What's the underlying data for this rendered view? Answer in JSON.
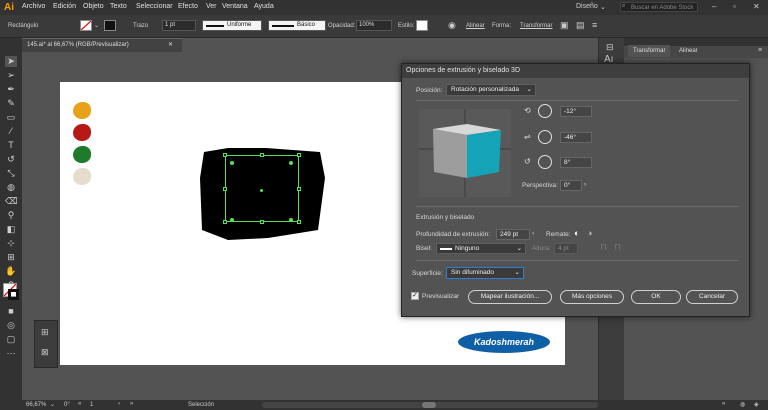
{
  "menubar": {
    "app_logo": "Ai",
    "items": [
      "Archivo",
      "Edición",
      "Objeto",
      "Texto",
      "Seleccionar",
      "Efecto",
      "Ver",
      "Ventana",
      "Ayuda"
    ],
    "workspace": "Diseño",
    "search_placeholder": "Buscar en Adobe Stock"
  },
  "controlbar": {
    "object_type": "Rectángulo",
    "stroke_label": "Trazo",
    "stroke_weight": "1 pt",
    "profile": "Uniforme",
    "brush": "Básico",
    "opacity_label": "Opacidad:",
    "opacity_value": "100%",
    "style_label": "Estilo:",
    "align_label": "Alinear",
    "shape_label": "Forma:",
    "transform_label": "Transformar"
  },
  "document": {
    "tab_title": "145.ai* al 66,67% (RGB/Previsualizar)"
  },
  "colors": {
    "blob1": "#e8a21a",
    "blob2": "#b51a17",
    "blob3": "#1f7a2c",
    "blob4": "#e6dccb",
    "cube_side": "#9d9d9d",
    "cube_front": "#15a3b8",
    "logo_bg": "#0f5fa6"
  },
  "logo_text": "Kadoshmerah",
  "panels": {
    "tabs": [
      "Transformar",
      "Alinear"
    ]
  },
  "dialog": {
    "title": "Opciones de extrusión y biselado 3D",
    "position_label": "Posición:",
    "position_value": "Rotación personalizada",
    "rot_x": "-12°",
    "rot_y": "-46°",
    "rot_z": "8°",
    "perspective_label": "Perspectiva:",
    "perspective_value": "0°",
    "extrusion_section": "Extrusión y biselado",
    "depth_label": "Profundidad de extrusión:",
    "depth_value": "249 pt",
    "cap_label": "Remate:",
    "bevel_label": "Bisel:",
    "bevel_value": "Ninguno",
    "height_label": "Altura:",
    "height_value": "4 pt",
    "surface_label": "Superficie:",
    "surface_value": "Sin difuminado",
    "preview_label": "Previsualizar",
    "map_button": "Mapear ilustración...",
    "more_button": "Más opciones",
    "ok_button": "OK",
    "cancel_button": "Cancelar"
  },
  "statusbar": {
    "zoom": "66,67%",
    "rotation": "0°",
    "artboard_number": "1",
    "tool": "Selección"
  }
}
